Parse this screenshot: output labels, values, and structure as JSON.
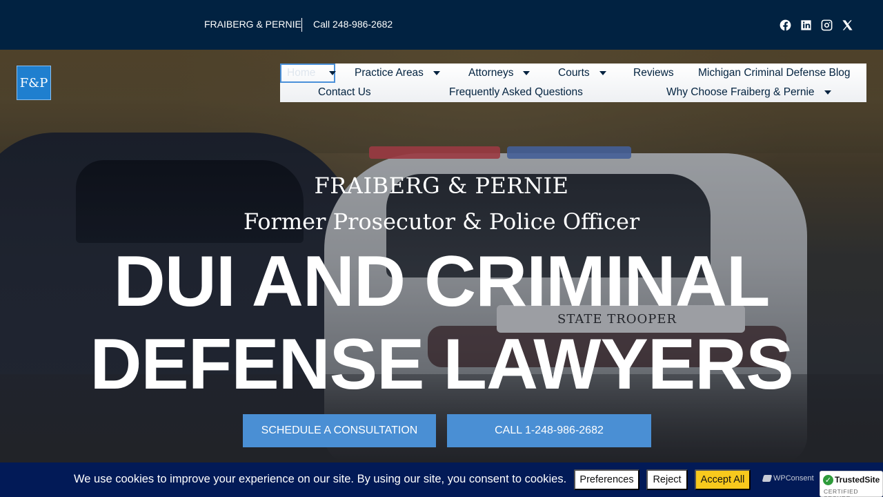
{
  "topbar": {
    "brand": "FRAIBERG & PERNIE",
    "phone": "Call 248-986-2682",
    "social": [
      "facebook-icon",
      "linkedin-icon",
      "instagram-icon",
      "x-icon"
    ]
  },
  "logo": {
    "text": "F&P"
  },
  "nav": {
    "items": [
      {
        "label": "Home",
        "has_caret": true
      },
      {
        "label": "Practice Areas",
        "has_caret": true
      },
      {
        "label": "Attorneys",
        "has_caret": true
      },
      {
        "label": "Courts",
        "has_caret": true
      },
      {
        "label": "Reviews",
        "has_caret": false
      },
      {
        "label": "Michigan Criminal Defense Blog",
        "has_caret": false
      },
      {
        "label": "Contact Us",
        "has_caret": false
      },
      {
        "label": "Frequently Asked Questions",
        "has_caret": false
      },
      {
        "label": "Why Choose Fraiberg & Pernie",
        "has_caret": true
      }
    ]
  },
  "hero": {
    "firm": "FRAIBERG & PERNIE",
    "subtitle": "Former Prosecutor & Police Officer",
    "headline_line1": "DUI AND CRIMINAL",
    "headline_line2": "DEFENSE LAWYERS",
    "vehicle_text": "STATE TROOPER",
    "cta_schedule": "SCHEDULE A CONSULTATION",
    "cta_call": "CALL 1-248-986-2682"
  },
  "cookie": {
    "message": "We use cookies to improve your experience on our site. By using our site, you consent to cookies.",
    "preferences": "Preferences",
    "reject": "Reject",
    "accept": "Accept All",
    "powered_by": "WPConsent"
  },
  "trusted_site": {
    "title": "TrustedSite",
    "subtitle": "CERTIFIED SECURE"
  },
  "colors": {
    "topbar": "#012241",
    "accent": "#4a8fd4",
    "cookie_bar": "#021a57",
    "accept_button": "#f8c91d"
  }
}
